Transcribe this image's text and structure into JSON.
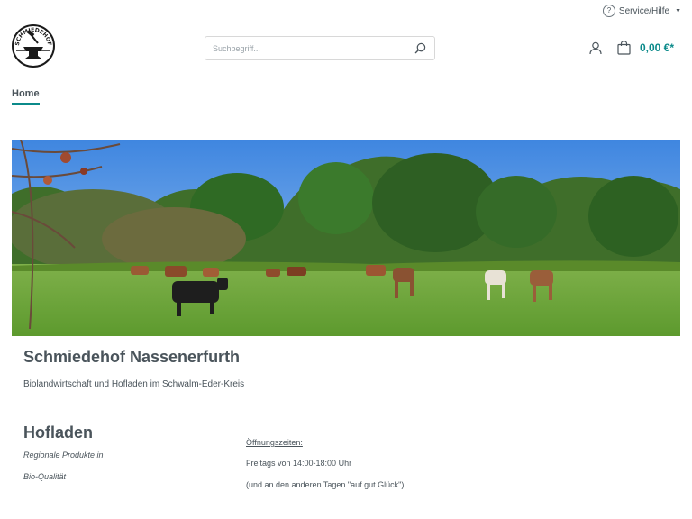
{
  "topbar": {
    "service_label": "Service/Hilfe",
    "service_icon": "question-circle-icon"
  },
  "logo": {
    "text": "SCHMIEDEHOF",
    "icon": "anvil-logo-icon"
  },
  "search": {
    "placeholder": "Suchbegriff...",
    "icon": "search-icon"
  },
  "header": {
    "account_icon": "user-icon",
    "cart_icon": "shopping-bag-icon",
    "cart_total": "0,00 €*"
  },
  "nav": {
    "items": [
      {
        "label": "Home",
        "active": true
      }
    ]
  },
  "hero": {
    "image": "pasture-with-cattle-and-horses"
  },
  "content": {
    "title": "Schmiedehof Nassenerfurth",
    "subtitle": "Biolandwirtschaft und Hofladen im Schwalm-Eder-Kreis",
    "hofladen": {
      "heading": "Hofladen",
      "line1": "Regionale Produkte in",
      "line2": "Bio-Qualität"
    },
    "hours": {
      "label": "Öffnungszeiten:",
      "line1": "Freitags von 14:00-18:00 Uhr",
      "line2": "(und an den anderen Tagen \"auf gut Glück\")"
    }
  },
  "colors": {
    "accent": "#0b8a8a",
    "text": "#4a545b",
    "border": "#d8d8d8"
  }
}
